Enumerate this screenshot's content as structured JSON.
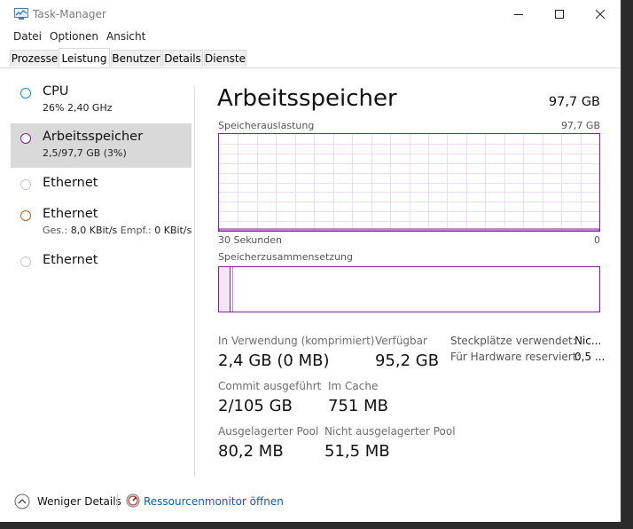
{
  "window": {
    "title": "Task-Manager"
  },
  "menu": [
    "Datei",
    "Optionen",
    "Ansicht"
  ],
  "tabs": [
    "Prozesse",
    "Leistung",
    "Benutzer",
    "Details",
    "Dienste"
  ],
  "sidebar": {
    "items": [
      {
        "title": "CPU",
        "sub": "26%  2,40 GHz",
        "color": "#1a8cc2"
      },
      {
        "title": "Arbeitsspeicher",
        "sub": "2,5/97,7 GB (3%)",
        "color": "#8b1aa6"
      },
      {
        "title": "Ethernet",
        "sub": "",
        "color": "#c8c8c8"
      },
      {
        "title": "Ethernet",
        "sub_send_label": "Ges.:",
        "sub_send": "8,0 KBit/s",
        "sub_recv_label": "Empf.:",
        "sub_recv": "0 KBit/s",
        "color": "#b8621b"
      },
      {
        "title": "Ethernet",
        "sub": "",
        "color": "#c8c8c8"
      }
    ]
  },
  "main": {
    "heading": "Arbeitsspeicher",
    "total": "97,7 GB",
    "usage_label": "Speicherauslastung",
    "usage_max": "97,7 GB",
    "time_left": "30 Sekunden",
    "time_right": "0",
    "composition_label": "Speicherzusammensetzung",
    "in_use_label": "In Verwendung (komprimiert)",
    "in_use_value": "2,4 GB (0 MB)",
    "available_label": "Verfügbar",
    "available_value": "95,2 GB",
    "slots_label": "Steckplätze verwendet:",
    "slots_value": "Nic...",
    "hw_reserved_label": "Für Hardware reserviert:",
    "hw_reserved_value": "0,5 ...",
    "commit_label": "Commit ausgeführt",
    "commit_value": "2/105 GB",
    "cache_label": "Im Cache",
    "cache_value": "751 MB",
    "paged_label": "Ausgelagerter Pool",
    "paged_value": "80,2 MB",
    "nonpaged_label": "Nicht ausgelagerter Pool",
    "nonpaged_value": "51,5 MB",
    "accent": "#8b1aa6"
  },
  "footer": {
    "less_details": "Weniger Details",
    "resmon": "Ressourcenmonitor öffnen"
  }
}
